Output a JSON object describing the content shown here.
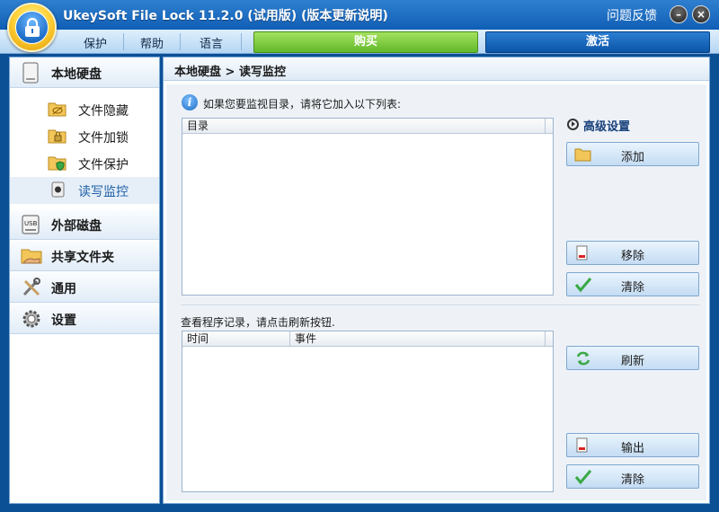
{
  "window": {
    "title": "UkeySoft File Lock 11.2.0 (试用版) (版本更新说明)",
    "feedback": "问题反馈",
    "minimize": "–",
    "close": "×"
  },
  "menu": {
    "items": [
      "保护",
      "帮助",
      "语言"
    ],
    "buy": "购买",
    "activate": "激活"
  },
  "nav": {
    "local_disk": "本地硬盘",
    "sub_items": [
      "文件隐藏",
      "文件加锁",
      "文件保护",
      "读写监控"
    ],
    "external_disk": "外部磁盘",
    "shared_folder": "共享文件夹",
    "general": "通用",
    "settings": "设置"
  },
  "main": {
    "breadcrumb": "本地硬盘 > 读写监控",
    "info": "如果您要监视目录，请将它加入以下列表:",
    "dir_col": "目录",
    "advanced": "高级设置",
    "add": "添加",
    "remove": "移除",
    "clear1": "清除",
    "log_info": "查看程序记录，请点击刷新按钮.",
    "time_col": "时间",
    "event_col": "事件",
    "refresh": "刷新",
    "export": "输出",
    "clear2": "清除"
  },
  "colors": {
    "accent_blue": "#105fb6",
    "buy_green": "#62b92a",
    "activate_blue": "#0b55a8"
  }
}
